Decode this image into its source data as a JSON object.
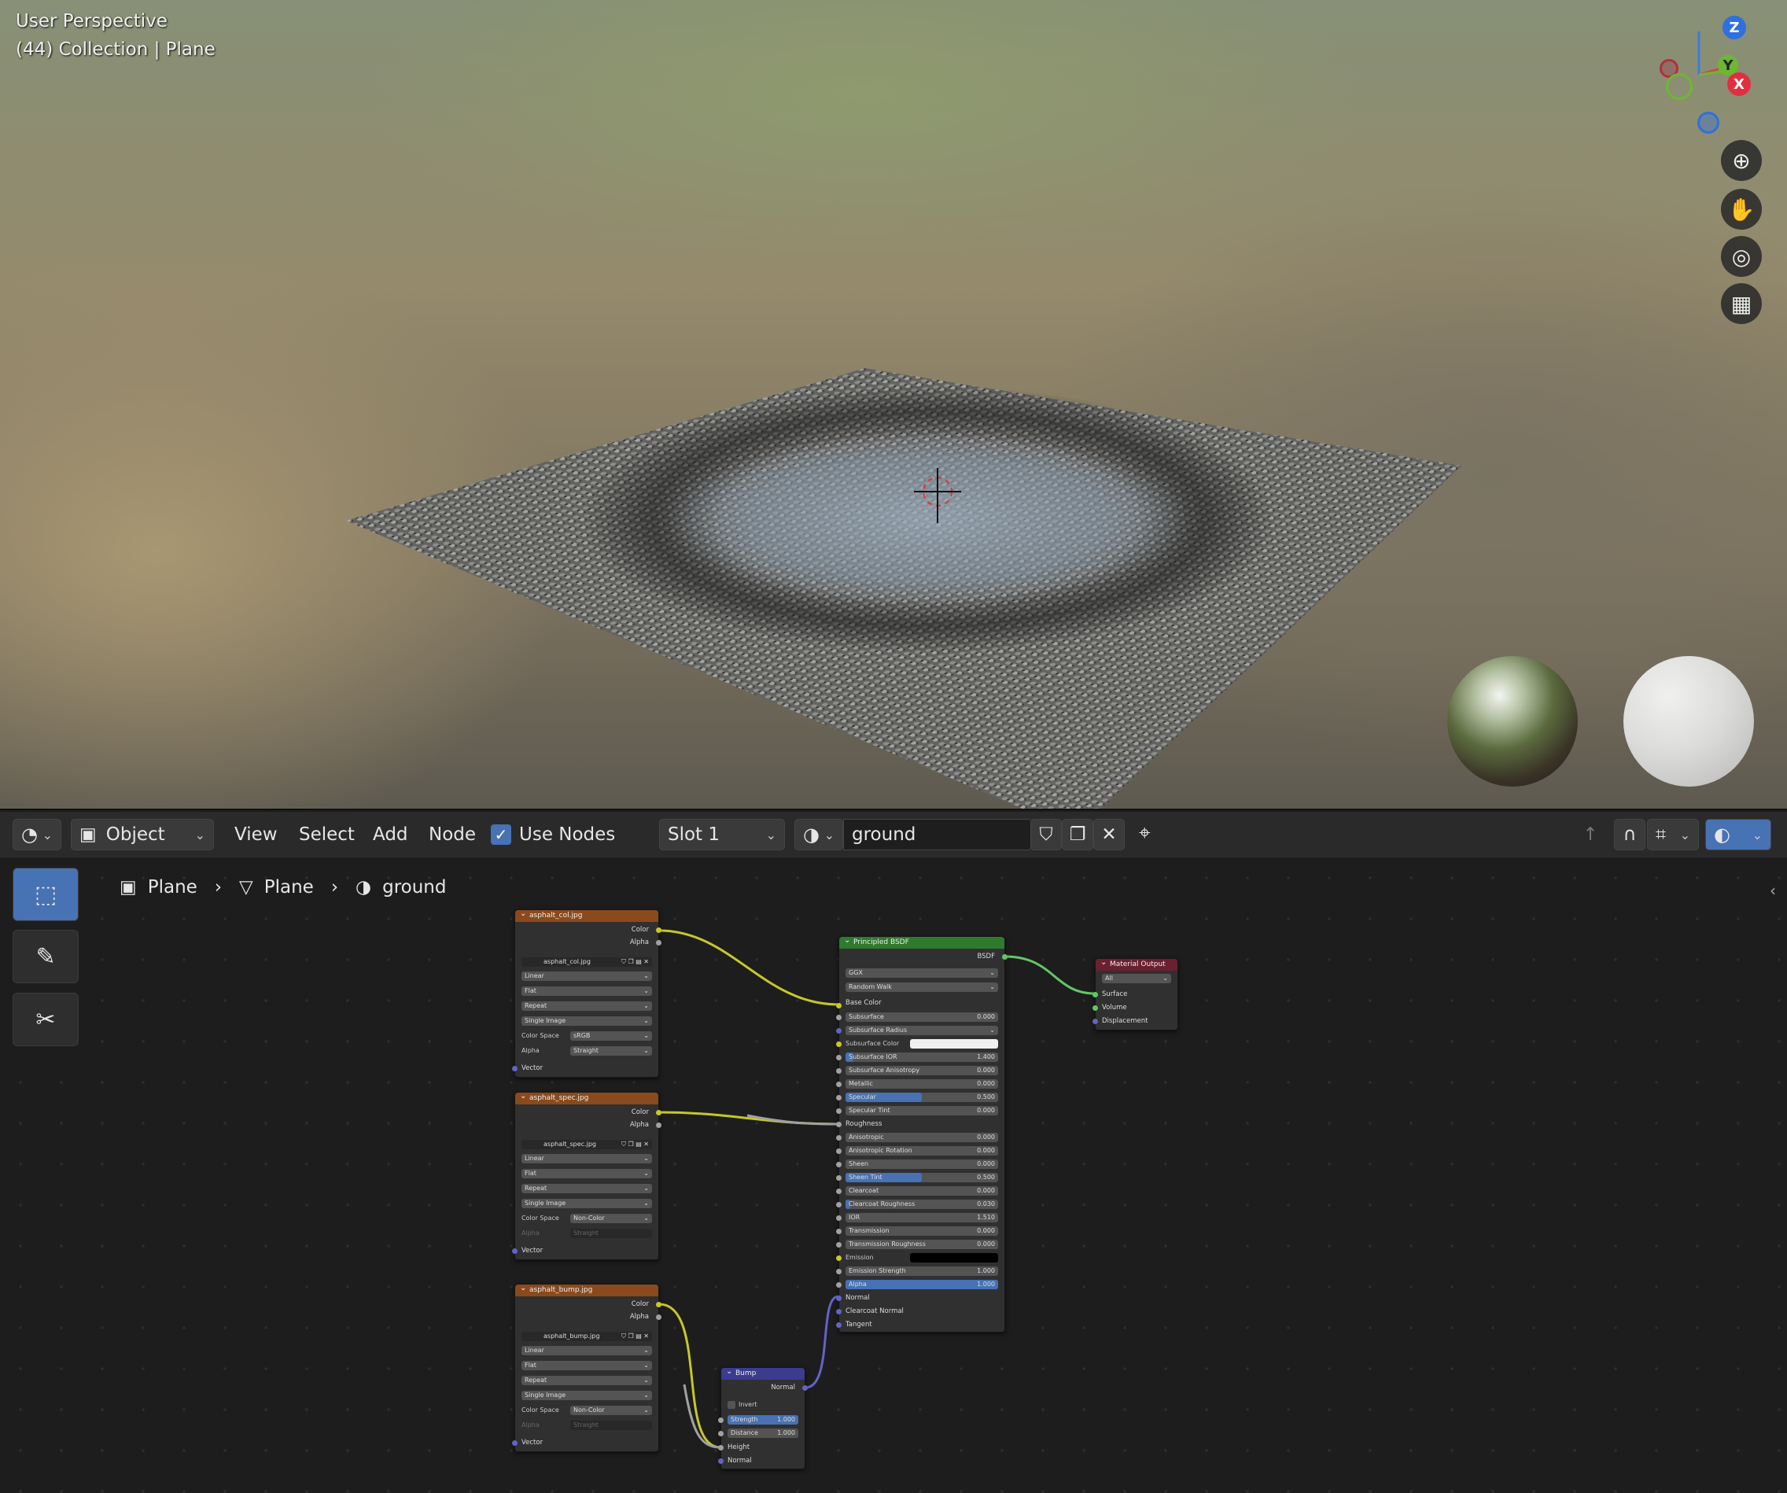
{
  "viewport": {
    "mode_label": "User Perspective",
    "context_label": "(44) Collection | Plane",
    "axes": {
      "z": "Z",
      "y": "Y",
      "x": "X"
    }
  },
  "header": {
    "editor_icon": "node-editor-icon",
    "mode_dropdown": "Object",
    "menus": [
      "View",
      "Select",
      "Add",
      "Node"
    ],
    "use_nodes_label": "Use Nodes",
    "use_nodes_checked": true,
    "slot_dropdown": "Slot 1",
    "material_name": "ground"
  },
  "breadcrumb": {
    "object": "Plane",
    "mesh": "Plane",
    "material": "ground"
  },
  "nodes": {
    "col": {
      "title": "asphalt_col.jpg",
      "outputs": [
        "Color",
        "Alpha"
      ],
      "image": "asphalt_col.jpg",
      "interpolation": "Linear",
      "projection": "Flat",
      "extension": "Repeat",
      "source": "Single Image",
      "color_space_label": "Color Space",
      "color_space": "sRGB",
      "alpha_label": "Alpha",
      "alpha": "Straight",
      "vector": "Vector"
    },
    "spec": {
      "title": "asphalt_spec.jpg",
      "outputs": [
        "Color",
        "Alpha"
      ],
      "image": "asphalt_spec.jpg",
      "interpolation": "Linear",
      "projection": "Flat",
      "extension": "Repeat",
      "source": "Single Image",
      "color_space_label": "Color Space",
      "color_space": "Non-Color",
      "alpha_label": "Alpha",
      "alpha": "Straight",
      "vector": "Vector"
    },
    "bump_img": {
      "title": "asphalt_bump.jpg",
      "outputs": [
        "Color",
        "Alpha"
      ],
      "image": "asphalt_bump.jpg",
      "interpolation": "Linear",
      "projection": "Flat",
      "extension": "Repeat",
      "source": "Single Image",
      "color_space_label": "Color Space",
      "color_space": "Non-Color",
      "alpha_label": "Alpha",
      "alpha": "Straight",
      "vector": "Vector"
    },
    "bsdf": {
      "title": "Principled BSDF",
      "output": "BSDF",
      "distribution": "GGX",
      "subsurface_method": "Random Walk",
      "base_color": "Base Color",
      "params": [
        {
          "label": "Subsurface",
          "value": "0.000",
          "fill": 0
        },
        {
          "label": "Subsurface Radius",
          "value": "",
          "fill": 0,
          "dropdown": true
        },
        {
          "label": "Subsurface Color",
          "value": "",
          "fill": 0,
          "swatch": "#f0f0f0"
        },
        {
          "label": "Subsurface IOR",
          "value": "1.400",
          "fill": 0.05
        },
        {
          "label": "Subsurface Anisotropy",
          "value": "0.000",
          "fill": 0
        },
        {
          "label": "Metallic",
          "value": "0.000",
          "fill": 0
        },
        {
          "label": "Specular",
          "value": "0.500",
          "fill": 0.5
        },
        {
          "label": "Specular Tint",
          "value": "0.000",
          "fill": 0
        },
        {
          "label": "Roughness",
          "value": "",
          "fill": 0,
          "socket_only": true
        },
        {
          "label": "Anisotropic",
          "value": "0.000",
          "fill": 0
        },
        {
          "label": "Anisotropic Rotation",
          "value": "0.000",
          "fill": 0
        },
        {
          "label": "Sheen",
          "value": "0.000",
          "fill": 0
        },
        {
          "label": "Sheen Tint",
          "value": "0.500",
          "fill": 0.5
        },
        {
          "label": "Clearcoat",
          "value": "0.000",
          "fill": 0
        },
        {
          "label": "Clearcoat Roughness",
          "value": "0.030",
          "fill": 0.03
        },
        {
          "label": "IOR",
          "value": "1.510",
          "fill": 0
        },
        {
          "label": "Transmission",
          "value": "0.000",
          "fill": 0
        },
        {
          "label": "Transmission Roughness",
          "value": "0.000",
          "fill": 0
        },
        {
          "label": "Emission",
          "value": "",
          "fill": 0,
          "swatch": "#000000"
        },
        {
          "label": "Emission Strength",
          "value": "1.000",
          "fill": 0
        },
        {
          "label": "Alpha",
          "value": "1.000",
          "fill": 1
        }
      ],
      "vector_inputs": [
        "Normal",
        "Clearcoat Normal",
        "Tangent"
      ]
    },
    "output": {
      "title": "Material Output",
      "target": "All",
      "inputs": [
        "Surface",
        "Volume",
        "Displacement"
      ]
    },
    "bump": {
      "title": "Bump",
      "output": "Normal",
      "invert_label": "Invert",
      "strength_label": "Strength",
      "strength": "1.000",
      "distance_label": "Distance",
      "distance": "1.000",
      "inputs": [
        "Height",
        "Normal"
      ]
    }
  },
  "colors": {
    "texture_header": "#8b4a1c",
    "shader_header": "#2e7a2e",
    "output_header": "#6b2030",
    "vector_header": "#3b3b8f",
    "active_tool": "#4772b3",
    "link_color": "#c7c729",
    "link_gray": "#a1a1a1",
    "link_green": "#63c763",
    "link_blue": "#6363c7"
  }
}
